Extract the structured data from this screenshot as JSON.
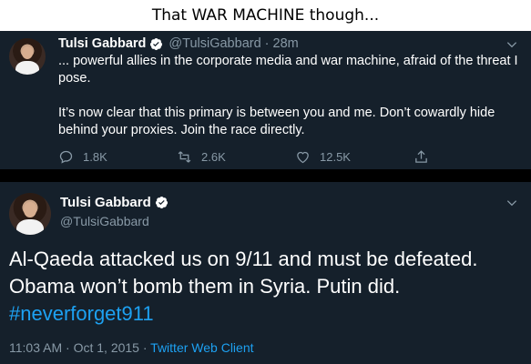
{
  "caption": "That WAR MACHINE though...",
  "colors": {
    "background_dark": "#15202b",
    "divider": "#000000",
    "text_primary": "#ffffff",
    "text_secondary": "#8899a6",
    "accent_blue": "#1da1f2"
  },
  "tweet1": {
    "display_name": "Tulsi Gabbard",
    "handle": "@TulsiGabbard",
    "separator": "·",
    "time": "28m",
    "paragraphs": [
      "... powerful allies in the corporate media and war machine, afraid of the threat I pose.",
      "It’s now clear that this primary is between you and me. Don’t cowardly hide behind your proxies. Join the race directly."
    ],
    "replies": "1.8K",
    "retweets": "2.6K",
    "likes": "12.5K"
  },
  "tweet2": {
    "display_name": "Tulsi Gabbard",
    "handle": "@TulsiGabbard",
    "text_line1": "Al-Qaeda attacked us on 9/11 and must be defeated.",
    "text_line2": "Obama won’t bomb them in Syria. Putin did.",
    "hashtag": "#neverforget911",
    "time": "11:03 AM",
    "sep1": "·",
    "date": "Oct 1, 2015",
    "sep2": "·",
    "client": "Twitter Web Client"
  },
  "icons": {
    "verified": "verified-badge-icon",
    "chevron": "chevron-down-icon",
    "reply": "reply-icon",
    "retweet": "retweet-icon",
    "like": "heart-icon",
    "share": "share-icon"
  }
}
